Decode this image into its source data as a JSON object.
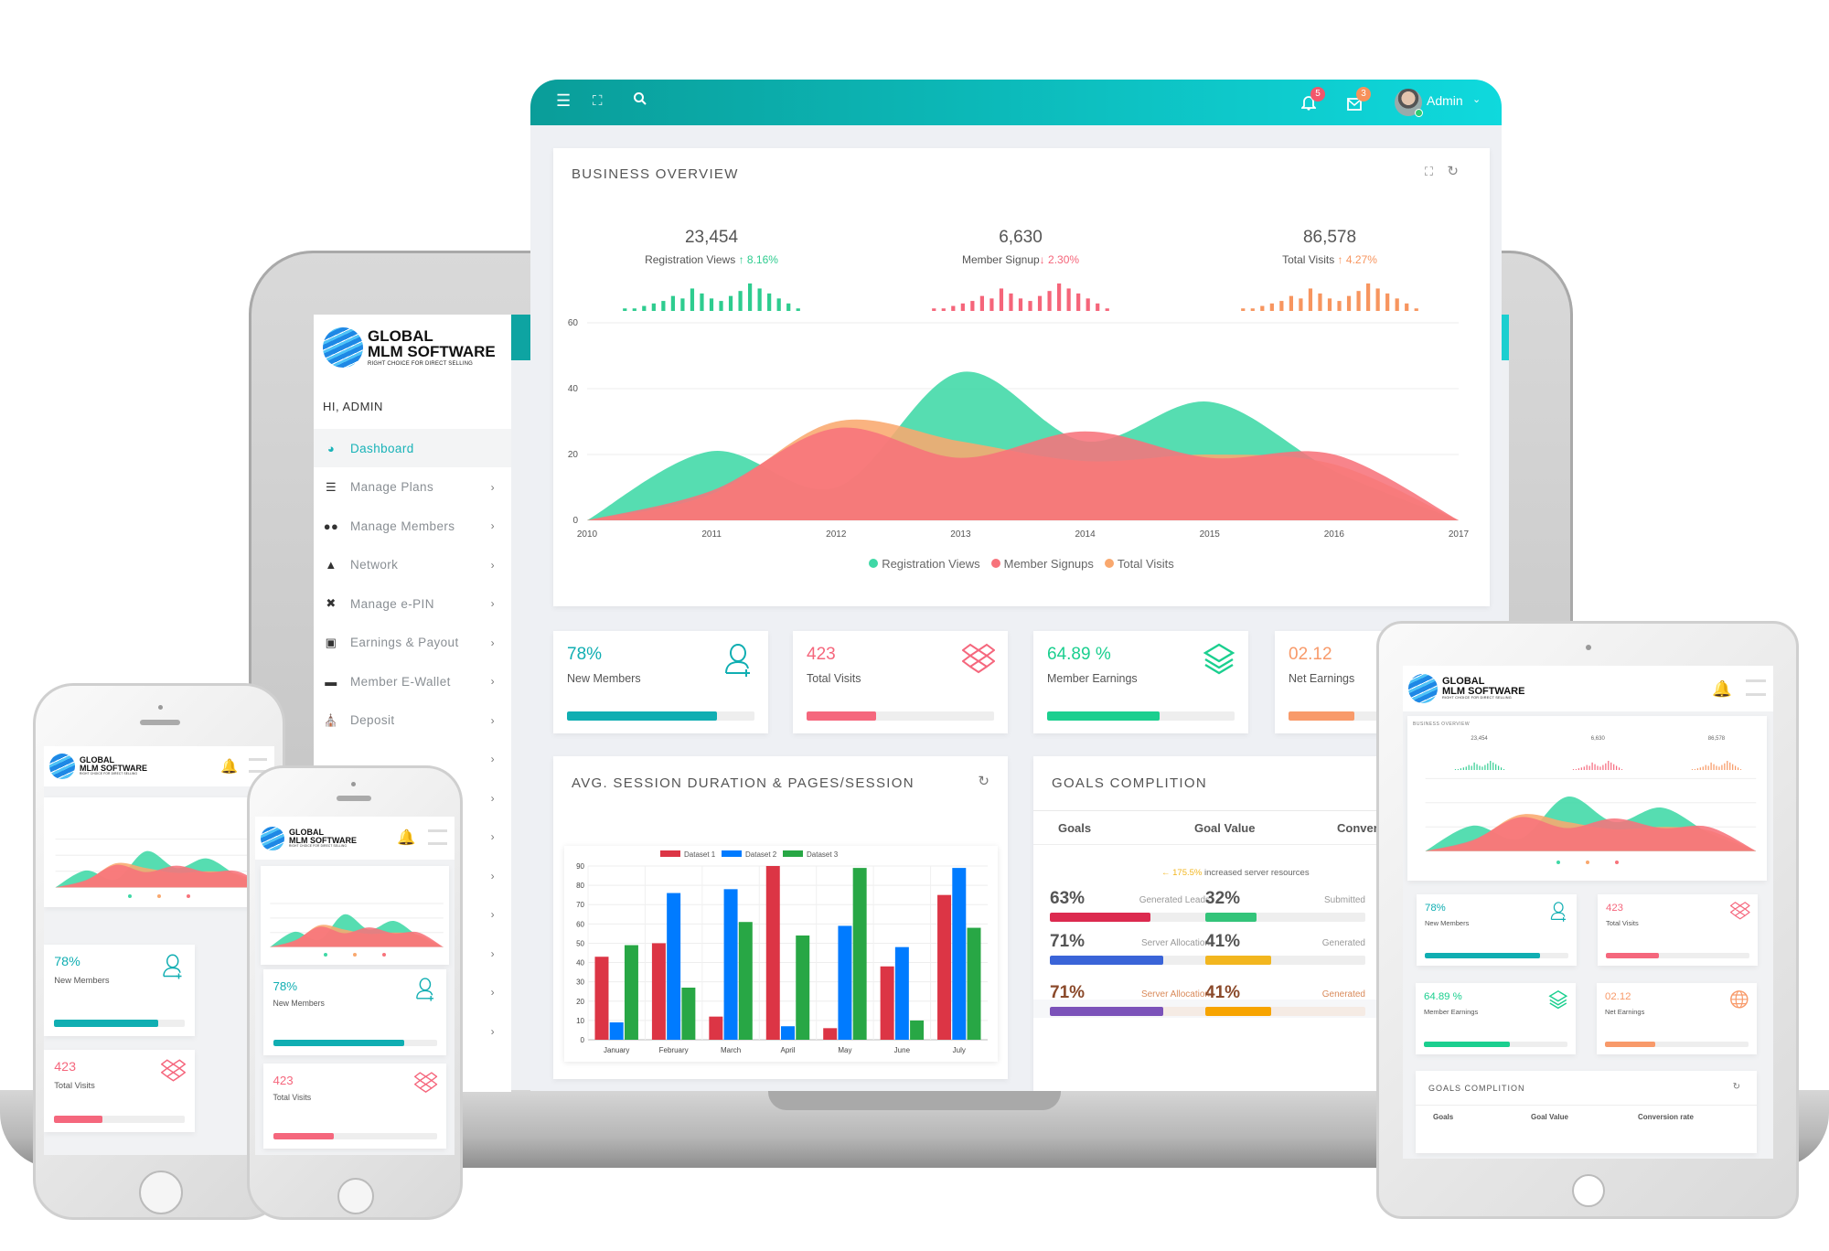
{
  "brand": {
    "line1": "GLOBAL",
    "line2": "MLM SOFTWARE",
    "tagline": "RIGHT CHOICE FOR DIRECT SELLING"
  },
  "topbar": {
    "notifications_count": "5",
    "messages_count": "3",
    "user_name": "Admin"
  },
  "sidebar": {
    "greeting": "HI, ADMIN",
    "items": [
      {
        "label": "Dashboard",
        "icon": "dashboard-icon",
        "active": true
      },
      {
        "label": "Manage Plans",
        "icon": "list-icon"
      },
      {
        "label": "Manage Members",
        "icon": "users-icon"
      },
      {
        "label": "Network",
        "icon": "sitemap-icon"
      },
      {
        "label": "Manage e-PIN",
        "icon": "xing-icon"
      },
      {
        "label": "Earnings & Payout",
        "icon": "money-icon"
      },
      {
        "label": "Member E-Wallet",
        "icon": "visa-card-icon"
      },
      {
        "label": "Deposit",
        "icon": "bank-icon"
      }
    ]
  },
  "overview": {
    "title": "BUSINESS OVERVIEW",
    "stats": [
      {
        "value": "23,454",
        "label": "Registration Views",
        "change": "8.16%",
        "direction": "up",
        "color": "#2ecc8f"
      },
      {
        "value": "6,630",
        "label": "Member Signup",
        "change": "2.30%",
        "direction": "down",
        "color": "#f5657a"
      },
      {
        "value": "86,578",
        "label": "Total Visits",
        "change": "4.27%",
        "direction": "up",
        "color": "#f7955f"
      }
    ]
  },
  "stat_cards": [
    {
      "value": "78%",
      "label": "New Members",
      "icon": "user-plus-icon",
      "color": "#10aeb2",
      "progress": 0.8
    },
    {
      "value": "423",
      "label": "Total Visits",
      "icon": "dropbox-icon",
      "color": "#f5677d",
      "progress": 0.37
    },
    {
      "value": "64.89 %",
      "label": "Member Earnings",
      "icon": "layers-icon",
      "color": "#1bcf8f",
      "progress": 0.6
    },
    {
      "value": "02.12",
      "label": "Net Earnings",
      "icon": "globe-icon",
      "color": "#f89a6a",
      "progress": 0.35
    }
  ],
  "session": {
    "title": "AVG. SESSION DURATION & PAGES/SESSION"
  },
  "goals": {
    "title": "GOALS COMPLITION",
    "columns": [
      "Goals",
      "Goal Value",
      "Conversion rate"
    ],
    "note_value": "175.5%",
    "note_text": "increased server resources",
    "items": [
      {
        "pct": "63%",
        "value": 0.63,
        "label": "Generated Leads",
        "color": "#dc2a4f"
      },
      {
        "pct": "32%",
        "value": 0.32,
        "label": "Submitted",
        "color": "#33c47a"
      },
      {
        "pct": "71%",
        "value": 0.71,
        "label": "Server Allocation",
        "color": "#3a64d8"
      },
      {
        "pct": "41%",
        "value": 0.41,
        "label": "Generated",
        "color": "#f2b61f"
      },
      {
        "pct": "71%",
        "value": 0.71,
        "label": "Server Allocation",
        "color": "#7b52b9",
        "highlight": true
      },
      {
        "pct": "41%",
        "value": 0.41,
        "label": "Generated",
        "color": "#f7a400",
        "highlight": true
      }
    ]
  },
  "chart_data": [
    {
      "type": "area",
      "x": [
        2010,
        2011,
        2012,
        2013,
        2014,
        2015,
        2016,
        2017
      ],
      "ylim": [
        0,
        60
      ],
      "yticks": [
        0,
        20,
        40,
        60
      ],
      "legend": "bottom",
      "grid": true,
      "series": [
        {
          "name": "Registration Views",
          "color": "#3fd8a6",
          "values": [
            0,
            21,
            10,
            45,
            24,
            36,
            15,
            0
          ]
        },
        {
          "name": "Total Visits",
          "color": "#f9a86e",
          "values": [
            0,
            8,
            30,
            24,
            18,
            20,
            17,
            0
          ]
        },
        {
          "name": "Member Signups",
          "color": "#f7737b",
          "values": [
            0,
            9,
            28,
            19,
            27,
            19,
            20,
            0
          ]
        }
      ],
      "legend_order": [
        "Registration Views",
        "Member Signups",
        "Total Visits"
      ]
    },
    {
      "type": "bar",
      "categories": [
        "January",
        "February",
        "March",
        "April",
        "May",
        "June",
        "July"
      ],
      "ylim": [
        0,
        90
      ],
      "yticks": [
        0,
        10,
        20,
        30,
        40,
        50,
        60,
        70,
        80,
        90
      ],
      "legend": "top",
      "grid": true,
      "series": [
        {
          "name": "Dataset 1",
          "color": "#dc3545",
          "values": [
            43,
            50,
            12,
            90,
            6,
            38,
            75
          ]
        },
        {
          "name": "Dataset 2",
          "color": "#007bff",
          "values": [
            9,
            76,
            78,
            7,
            59,
            48,
            89
          ]
        },
        {
          "name": "Dataset 3",
          "color": "#28a745",
          "values": [
            49,
            27,
            61,
            54,
            89,
            10,
            58
          ]
        }
      ]
    },
    {
      "type": "bar",
      "name_hint": "sparkline",
      "values": [
        1,
        1,
        2,
        3,
        4,
        6,
        5,
        9,
        7,
        5,
        4,
        6,
        8,
        11,
        9,
        7,
        5,
        3,
        1
      ]
    }
  ]
}
